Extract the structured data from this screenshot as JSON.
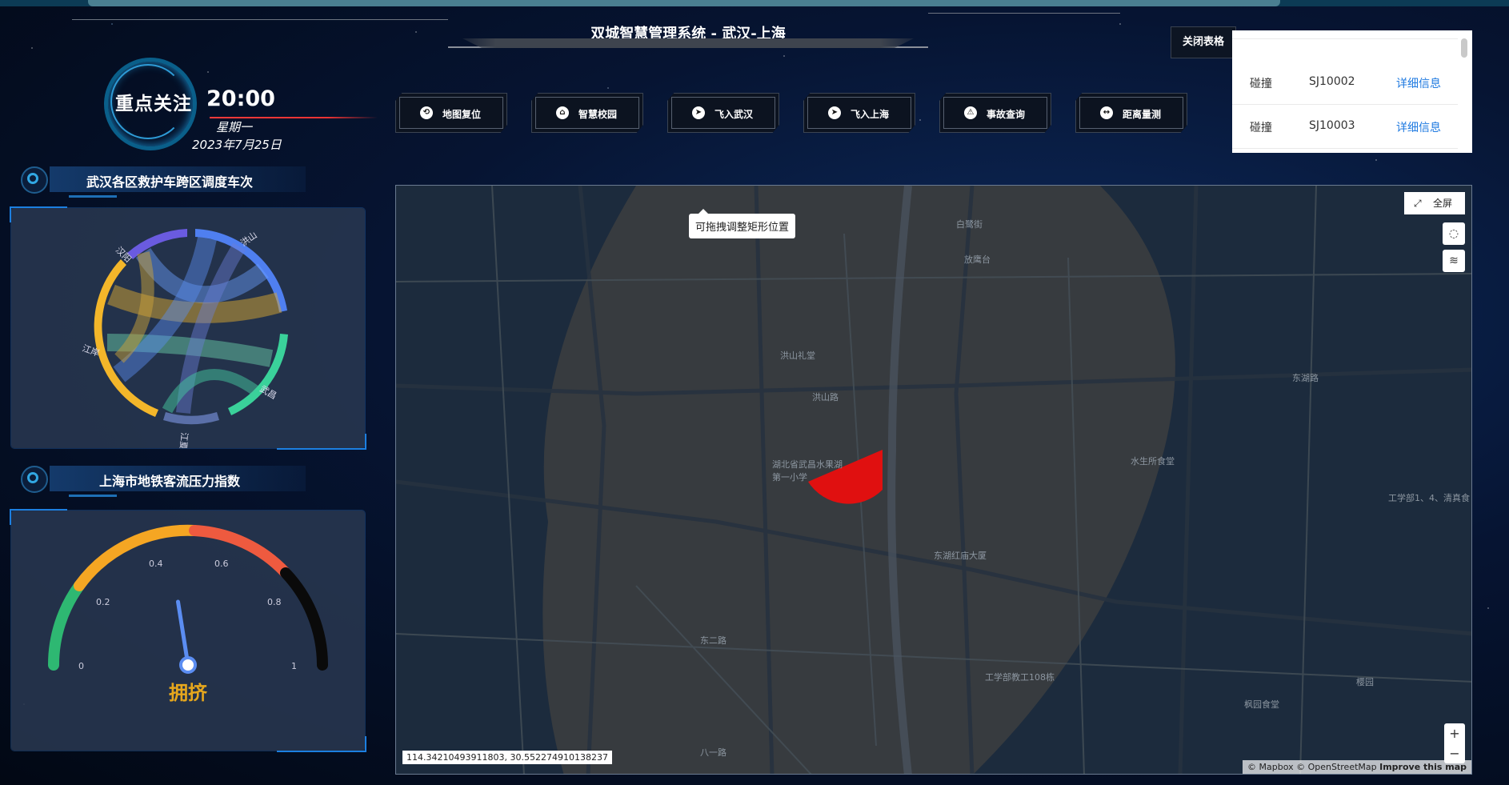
{
  "header": {
    "title": "双城智慧管理系统 - 武汉-上海"
  },
  "clock": {
    "focus_label": "重点关注",
    "time": "20:00",
    "weekday": "星期一",
    "date": "2023年7月25日"
  },
  "nav": {
    "items": [
      {
        "label": "地图复位",
        "icon": "map-reset-icon"
      },
      {
        "label": "智慧校园",
        "icon": "campus-icon"
      },
      {
        "label": "飞入武汉",
        "icon": "fly-wuhan-icon"
      },
      {
        "label": "飞入上海",
        "icon": "fly-shanghai-icon"
      },
      {
        "label": "事故查询",
        "icon": "accident-query-icon"
      },
      {
        "label": "距离量测",
        "icon": "distance-measure-icon"
      }
    ]
  },
  "table": {
    "close_label": "关闭表格",
    "rows": [
      {
        "type": "碰撞",
        "id": "SJ10002",
        "action": "详细信息"
      },
      {
        "type": "碰撞",
        "id": "SJ10003",
        "action": "详细信息"
      }
    ]
  },
  "panel_chord": {
    "title": "武汉各区救护车跨区调度车次",
    "labels": [
      "汉阳",
      "洪山",
      "武昌",
      "江岸",
      "江夏"
    ]
  },
  "panel_gauge": {
    "title": "上海市地铁客流压力指数",
    "status": "拥挤",
    "ticks": [
      "0",
      "0.2",
      "0.4",
      "0.6",
      "0.8",
      "1"
    ],
    "value": 0.45
  },
  "map": {
    "tooltip": "可拖拽调整矩形位置",
    "fullscreen_label": "全屏",
    "coordinates": "114.34210493911803, 30.552274910138237",
    "attribution_a": "© Mapbox © OpenStreetMap",
    "attribution_b": "Improve this map",
    "places": [
      "放鹰台",
      "洪山礼堂",
      "洪山路",
      "湖北省武昌水果湖第一小学",
      "水生所食堂",
      "东湖红庙大厦",
      "工学部教工108栋",
      "工学部1、4、清真食",
      "樱园",
      "枫园食堂",
      "白鹭街",
      "东湖路",
      "东二路",
      "八一路"
    ],
    "zoom_in": "+",
    "zoom_out": "−"
  },
  "colors": {
    "accent": "#1c7fe0",
    "danger": "#e01010",
    "gauge_status": "#e6a71d"
  }
}
